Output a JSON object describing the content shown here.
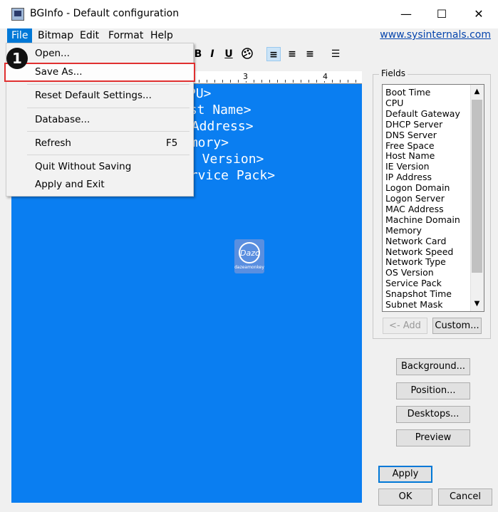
{
  "window": {
    "title": "BGInfo - Default configuration",
    "minimize": "—",
    "maximize": "☐",
    "close": "✕"
  },
  "menubar": {
    "items": [
      "File",
      "Bitmap",
      "Edit",
      "Format",
      "Help"
    ],
    "link": "www.sysinternals.com"
  },
  "toolbar": {
    "bold": "B",
    "italic": "I",
    "underline": "U",
    "icons": [
      "bold-icon",
      "italic-icon",
      "underline-icon",
      "color-palette-icon",
      "align-left-icon",
      "align-center-icon",
      "align-right-icon",
      "bullet-list-icon"
    ],
    "align_left": "≡",
    "align_center": "≡",
    "align_right": "≡",
    "bullets": "☰"
  },
  "ruler": {
    "marks": [
      "3",
      "4"
    ]
  },
  "canvas": {
    "background": "#0a7ef1",
    "lines": [
      "PU>",
      "ost Name>",
      " Address>",
      "emory>",
      "S Version>",
      "ervice Pack>"
    ]
  },
  "watermark": {
    "mark": "Dazo",
    "text": "dazeamonkey"
  },
  "fields": {
    "legend": "Fields",
    "items": [
      "Boot Time",
      "CPU",
      "Default Gateway",
      "DHCP Server",
      "DNS Server",
      "Free Space",
      "Host Name",
      "IE Version",
      "IP Address",
      "Logon Domain",
      "Logon Server",
      "MAC Address",
      "Machine Domain",
      "Memory",
      "Network Card",
      "Network Speed",
      "Network Type",
      "OS Version",
      "Service Pack",
      "Snapshot Time",
      "Subnet Mask"
    ],
    "add_button": "<- Add",
    "custom_button": "Custom..."
  },
  "side_buttons": {
    "background": "Background...",
    "position": "Position...",
    "desktops": "Desktops...",
    "preview": "Preview"
  },
  "footer_buttons": {
    "apply": "Apply",
    "ok": "OK",
    "cancel": "Cancel"
  },
  "file_menu": {
    "items": [
      "Open...",
      "Save As...",
      "Reset Default Settings...",
      "Database...",
      "Refresh",
      "Quit Without Saving",
      "Apply and Exit"
    ],
    "refresh_shortcut": "F5",
    "highlighted": "Save As...",
    "highlight_color": "#e03030"
  },
  "step_badge": "1"
}
